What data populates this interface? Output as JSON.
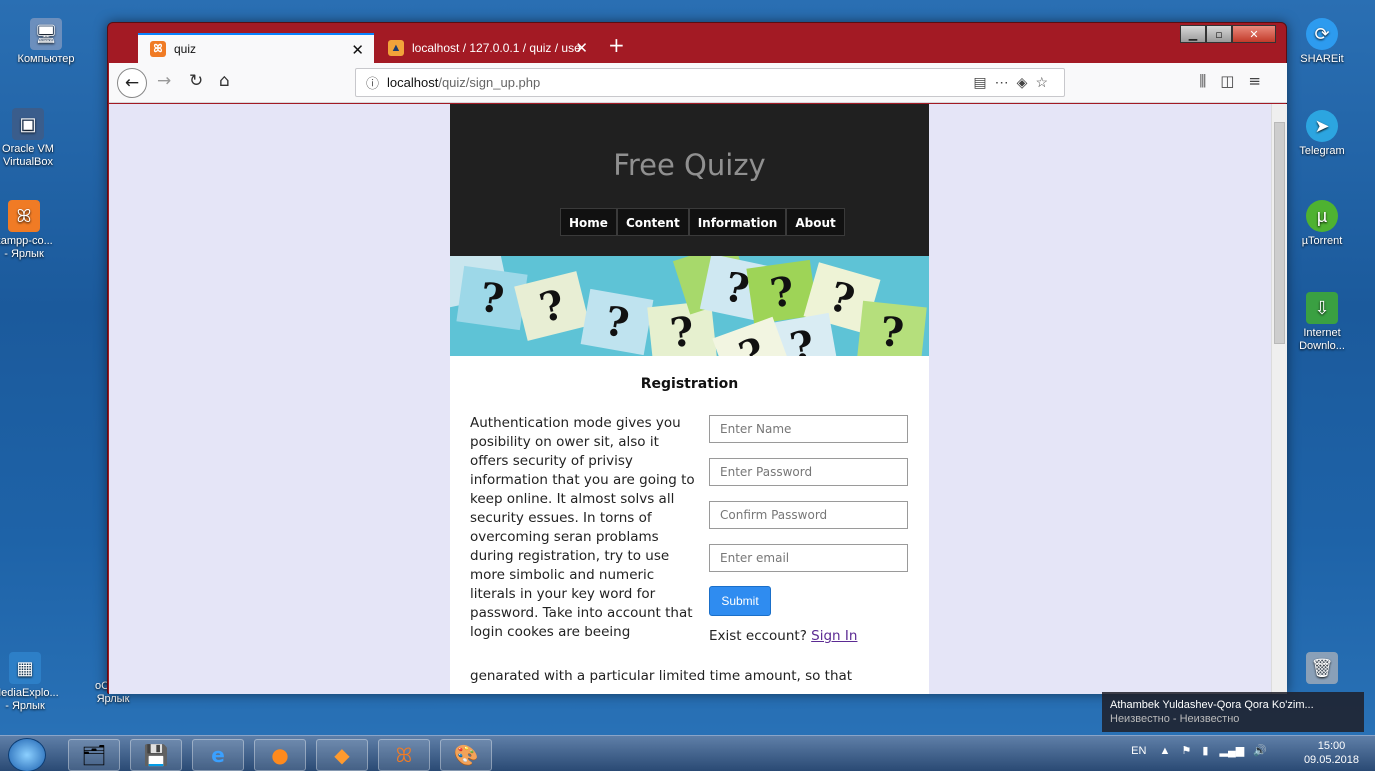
{
  "desktop": {
    "icons_left": [
      {
        "label": "Компьютер",
        "icon": "computer-icon"
      },
      {
        "label": "Oracle VM VirtualBox",
        "icon": "virtualbox-icon"
      },
      {
        "label": "xampp-co... - Ярлык",
        "icon": "xampp-icon"
      },
      {
        "label": "MediaExplo... - Ярлык",
        "icon": "mediaexplorer-icon"
      },
      {
        "label": "oCam - Ярлык",
        "icon": "ocam-icon"
      }
    ],
    "icons_right": [
      {
        "label": "SHAREit",
        "icon": "shareit-icon"
      },
      {
        "label": "Telegram",
        "icon": "telegram-icon"
      },
      {
        "label": "µTorrent",
        "icon": "utorrent-icon"
      },
      {
        "label": "Internet Downlo...",
        "icon": "internet-download-icon"
      },
      {
        "label": "",
        "icon": "recycle-bin-icon"
      }
    ]
  },
  "browser": {
    "tabs": [
      {
        "label": "quiz",
        "active": true
      },
      {
        "label": "localhost / 127.0.0.1 / quiz / use",
        "active": false
      }
    ],
    "new_tab": "+",
    "url": {
      "host": "localhost",
      "path": "/quiz/sign_up.php"
    }
  },
  "page": {
    "site_title": "Free Quizy",
    "menu": [
      "Home",
      "Content",
      "Information",
      "About"
    ],
    "registration_title": "Registration",
    "description": "Authentication mode gives you posibility on ower sit, also it offers security of privisy information that you are going to keep online. It almost solvs all security essues. In torns of overcoming seran problams during registration, try to use more simbolic and numeric literals in your key word for password. Take into account that login cookes are beeing",
    "description_tail": "genarated with a particular limited time amount, so that",
    "form": {
      "name_placeholder": "Enter Name",
      "password_placeholder": "Enter Password",
      "confirm_placeholder": "Confirm Password",
      "email_placeholder": "Enter email",
      "submit_label": "Submit",
      "exist_text": "Exist eccount?",
      "signin_link": "Sign In"
    }
  },
  "taskbar": {
    "language": "EN",
    "time": "15:00",
    "date": "09.05.2018"
  },
  "notification": {
    "title": "Athambek Yuldashev-Qora Qora Ko'zim...",
    "subtitle": "Неизвестно - Неизвестно"
  },
  "colors": {
    "accent": "#0a84ff",
    "window_frame": "#a31a24",
    "header_bg": "#202020",
    "submit_bg": "#2f8cf0",
    "link": "#5b2a93"
  }
}
